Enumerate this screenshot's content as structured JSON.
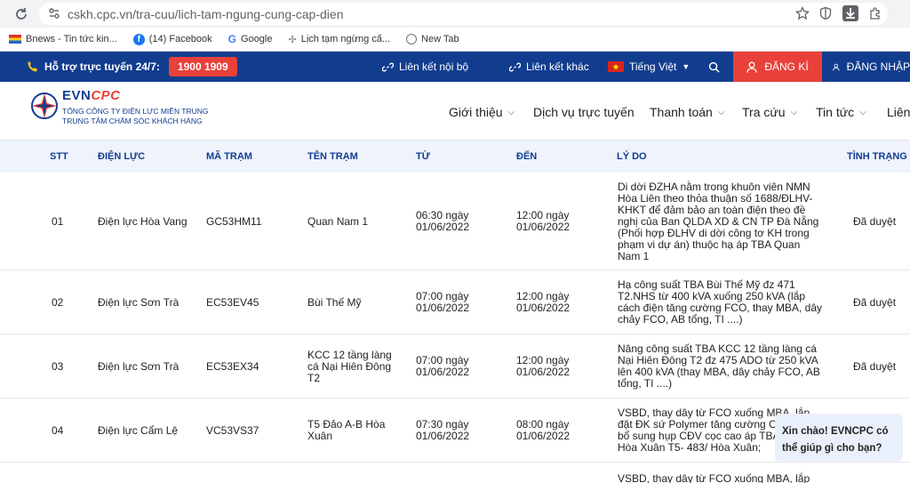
{
  "browser": {
    "url": "cskh.cpc.vn/tra-cuu/lich-tam-ngung-cung-cap-dien",
    "bookmarks": [
      "Bnews - Tin tức kin...",
      "(14) Facebook",
      "Google",
      "Lịch tạm ngừng cấ...",
      "New Tab"
    ]
  },
  "topbar": {
    "hotline_label": "Hỗ trợ trực tuyến 24/7:",
    "hotline_number": "1900 1909",
    "link_internal": "Liên kết nội bộ",
    "link_other": "Liên kết khác",
    "language": "Tiếng Việt",
    "register": "ĐĂNG KÍ",
    "login": "ĐĂNG NHẬP",
    "colors": {
      "navy": "#123d8f",
      "red": "#e9403a"
    }
  },
  "header": {
    "logo_brand_a": "EVN",
    "logo_brand_b": "CPC",
    "logo_line1": "TỔNG CÔNG TY ĐIỆN LỰC MIỀN TRUNG",
    "logo_line2": "TRUNG TÂM CHĂM SÓC KHÁCH HÀNG",
    "menu": [
      "Giới thiệu",
      "Dịch vụ trực tuyến",
      "Thanh toán",
      "Tra cứu",
      "Tin tức",
      "Liên"
    ]
  },
  "table": {
    "headers": [
      "STT",
      "ĐIỆN LỰC",
      "MÃ TRẠM",
      "TÊN TRẠM",
      "TỪ",
      "ĐẾN",
      "LÝ DO",
      "TÌNH TRẠNG"
    ],
    "rows": [
      {
        "stt": "01",
        "dien_luc": "Điện lực Hòa Vang",
        "ma_tram": "GC53HM11",
        "ten_tram": [
          "Quan Nam 1"
        ],
        "tu": [
          "06:30 ngày",
          "01/06/2022"
        ],
        "den": [
          "12:00 ngày",
          "01/06/2022"
        ],
        "ly_do": [
          "Di dời ĐZHA nằm trong khuôn viên NMN",
          "Hòa Liên theo thỏa thuận số 1688/ĐLHV-",
          "KHKT để đảm bảo an toàn điện theo đề",
          "nghị của Ban QLDA XD & CN TP Đà Nẵng",
          "(Phối hợp ĐLHV di dời công tơ KH trong",
          "phạm vi dự án) thuộc hạ áp TBA Quan",
          "Nam 1"
        ],
        "tinh_trang": "Đã duyệt"
      },
      {
        "stt": "02",
        "dien_luc": "Điện lực Sơn Trà",
        "ma_tram": "EC53EV45",
        "ten_tram": [
          "Bùi Thế Mỹ"
        ],
        "tu": [
          "07:00 ngày",
          "01/06/2022"
        ],
        "den": [
          "12:00 ngày",
          "01/06/2022"
        ],
        "ly_do": [
          "Hạ công suất TBA Bùi Thế Mỹ đz 471",
          "T2.NHS từ 400 kVA xuống 250 kVA (lắp",
          "cách điện tăng cường FCO, thay MBA, dây",
          "chảy FCO, AB tổng, TI ....)"
        ],
        "tinh_trang": "Đã duyệt"
      },
      {
        "stt": "03",
        "dien_luc": "Điện lực Sơn Trà",
        "ma_tram": "EC53EX34",
        "ten_tram": [
          "KCC 12 tầng làng",
          "cá Nại Hiên Đông",
          "T2"
        ],
        "tu": [
          "07:00 ngày",
          "01/06/2022"
        ],
        "den": [
          "12:00 ngày",
          "01/06/2022"
        ],
        "ly_do": [
          "Nâng công suất TBA KCC 12 tầng làng cá",
          "Nại Hiên Đông T2 đz 475 ADO từ 250 kVA",
          "lên 400 kVA (thay MBA, dây chảy FCO, AB",
          "tổng, TI ....)"
        ],
        "tinh_trang": "Đã duyệt"
      },
      {
        "stt": "04",
        "dien_luc": "Điện lực Cẩm Lệ",
        "ma_tram": "VC53VS37",
        "ten_tram": [
          "T5 Đảo A-B Hòa",
          "Xuân"
        ],
        "tu": [
          "07:30 ngày",
          "01/06/2022"
        ],
        "den": [
          "08:00 ngày",
          "01/06/2022"
        ],
        "ly_do": [
          "VSBD, thay dây từ FCO xuống MBA, lắp",
          "đặt ĐK sứ Polymer tăng cường CDD",
          "bổ sung hụp CĐV cọc cao áp TBA E",
          "Hòa Xuân T5- 483/ Hòa Xuân;"
        ],
        "tinh_trang": ""
      },
      {
        "stt": "",
        "dien_luc": "",
        "ma_tram": "",
        "ten_tram": [],
        "tu": [],
        "den": [],
        "ly_do": [
          "VSBD, thay dây từ FCO xuống MBA, lắp"
        ],
        "tinh_trang": ""
      }
    ]
  },
  "chat": {
    "line1": "Xin chào! EVNCPC có",
    "line2": "thể giúp gì cho bạn?"
  }
}
